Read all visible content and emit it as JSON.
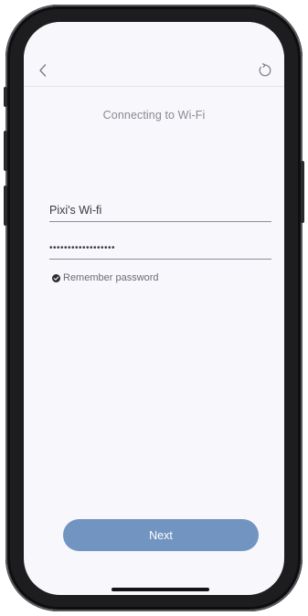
{
  "header": {
    "back_icon": "chevron-left-icon",
    "refresh_icon": "refresh-icon"
  },
  "main": {
    "title": "Connecting to Wi-Fi",
    "ssid": {
      "value": "Pixi's Wi-fi"
    },
    "password": {
      "value": "••••••••••••••••••"
    },
    "remember": {
      "label": "Remember password",
      "checked": true,
      "icon": "check-circle-icon"
    },
    "next_label": "Next"
  },
  "colors": {
    "background": "#f8f7fc",
    "title_text": "#8b8a92",
    "input_text": "#3a3a42",
    "underline": "#8e8d97",
    "button_bg": "#7294c1",
    "button_text": "#ffffff"
  }
}
